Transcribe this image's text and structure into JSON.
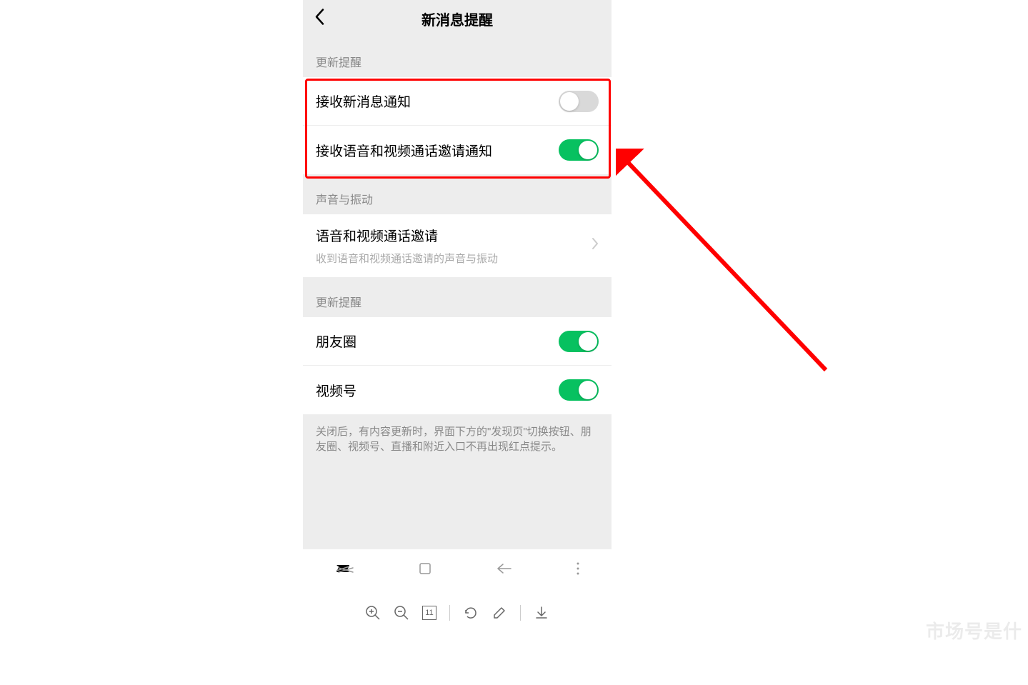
{
  "header": {
    "title": "新消息提醒"
  },
  "section1": {
    "title": "更新提醒",
    "rows": [
      {
        "label": "接收新消息通知",
        "toggle": false
      },
      {
        "label": "接收语音和视频通话邀请通知",
        "toggle": true
      }
    ]
  },
  "section2": {
    "title": "声音与振动",
    "rows": [
      {
        "label": "语音和视频通话邀请",
        "sub": "收到语音和视频通话邀请的声音与振动"
      }
    ]
  },
  "section3": {
    "title": "更新提醒",
    "rows": [
      {
        "label": "朋友圈",
        "toggle": true
      },
      {
        "label": "视频号",
        "toggle": true
      }
    ],
    "footnote": "关闭后，有内容更新时，界面下方的\"发现页\"切换按钮、朋友圈、视频号、直播和附近入口不再出现红点提示。"
  },
  "toolbar": {
    "pageNumber": "11"
  },
  "annotation": {
    "highlight_color": "#ff0000",
    "arrow_color": "#ff0000"
  },
  "watermark": "市场号是什"
}
